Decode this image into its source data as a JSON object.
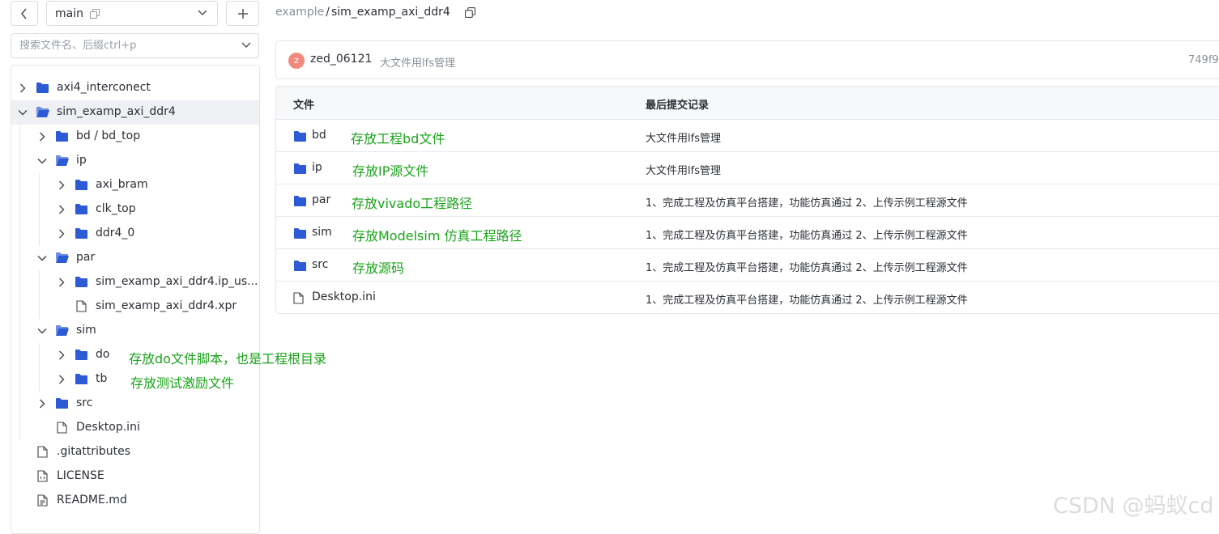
{
  "branch": {
    "name": "main"
  },
  "search": {
    "placeholder": "搜索文件名、后缀ctrl+p"
  },
  "tree": {
    "items": [
      {
        "label": "axi4_interconect"
      },
      {
        "label": "sim_examp_axi_ddr4"
      },
      {
        "label": "bd / bd_top"
      },
      {
        "label": "ip"
      },
      {
        "label": "axi_bram"
      },
      {
        "label": "clk_top"
      },
      {
        "label": "ddr4_0"
      },
      {
        "label": "par"
      },
      {
        "label": "sim_examp_axi_ddr4.ip_us..."
      },
      {
        "label": "sim_examp_axi_ddr4.xpr"
      },
      {
        "label": "sim"
      },
      {
        "label": "do"
      },
      {
        "label": "tb"
      },
      {
        "label": "src"
      },
      {
        "label": "Desktop.ini"
      },
      {
        "label": ".gitattributes"
      },
      {
        "label": "LICENSE"
      },
      {
        "label": "README.md"
      }
    ],
    "annotations": [
      "存放do文件脚本，也是工程根目录",
      "存放测试激励文件"
    ]
  },
  "breadcrumb": {
    "root": "example",
    "separator": "/",
    "current": "sim_examp_axi_ddr4"
  },
  "commit": {
    "avatar_letter": "z",
    "user": "zed_06121",
    "message": "大文件用lfs管理",
    "hash": "749f9"
  },
  "table": {
    "col_file": "文件",
    "col_commit": "最后提交记录",
    "rows": [
      {
        "name": "bd",
        "annotation": "存放工程bd文件",
        "commit": "大文件用lfs管理"
      },
      {
        "name": "ip",
        "annotation": "存放IP源文件",
        "commit": "大文件用lfs管理"
      },
      {
        "name": "par",
        "annotation": "存放vivado工程路径",
        "commit": "1、完成工程及仿真平台搭建，功能仿真通过 2、上传示例工程源文件"
      },
      {
        "name": "sim",
        "annotation": "存放Modelsim 仿真工程路径",
        "commit": "1、完成工程及仿真平台搭建，功能仿真通过 2、上传示例工程源文件"
      },
      {
        "name": "src",
        "annotation": "存放源码",
        "commit": "1、完成工程及仿真平台搭建，功能仿真通过 2、上传示例工程源文件"
      },
      {
        "name": "Desktop.ini",
        "annotation": "",
        "commit": "1、完成工程及仿真平台搭建，功能仿真通过 2、上传示例工程源文件"
      }
    ]
  },
  "watermark": "CSDN @蚂蚁cd",
  "colors": {
    "folder": "#2d5bd6",
    "annotation": "#1aa31a",
    "avatar": "#f08a7b"
  }
}
